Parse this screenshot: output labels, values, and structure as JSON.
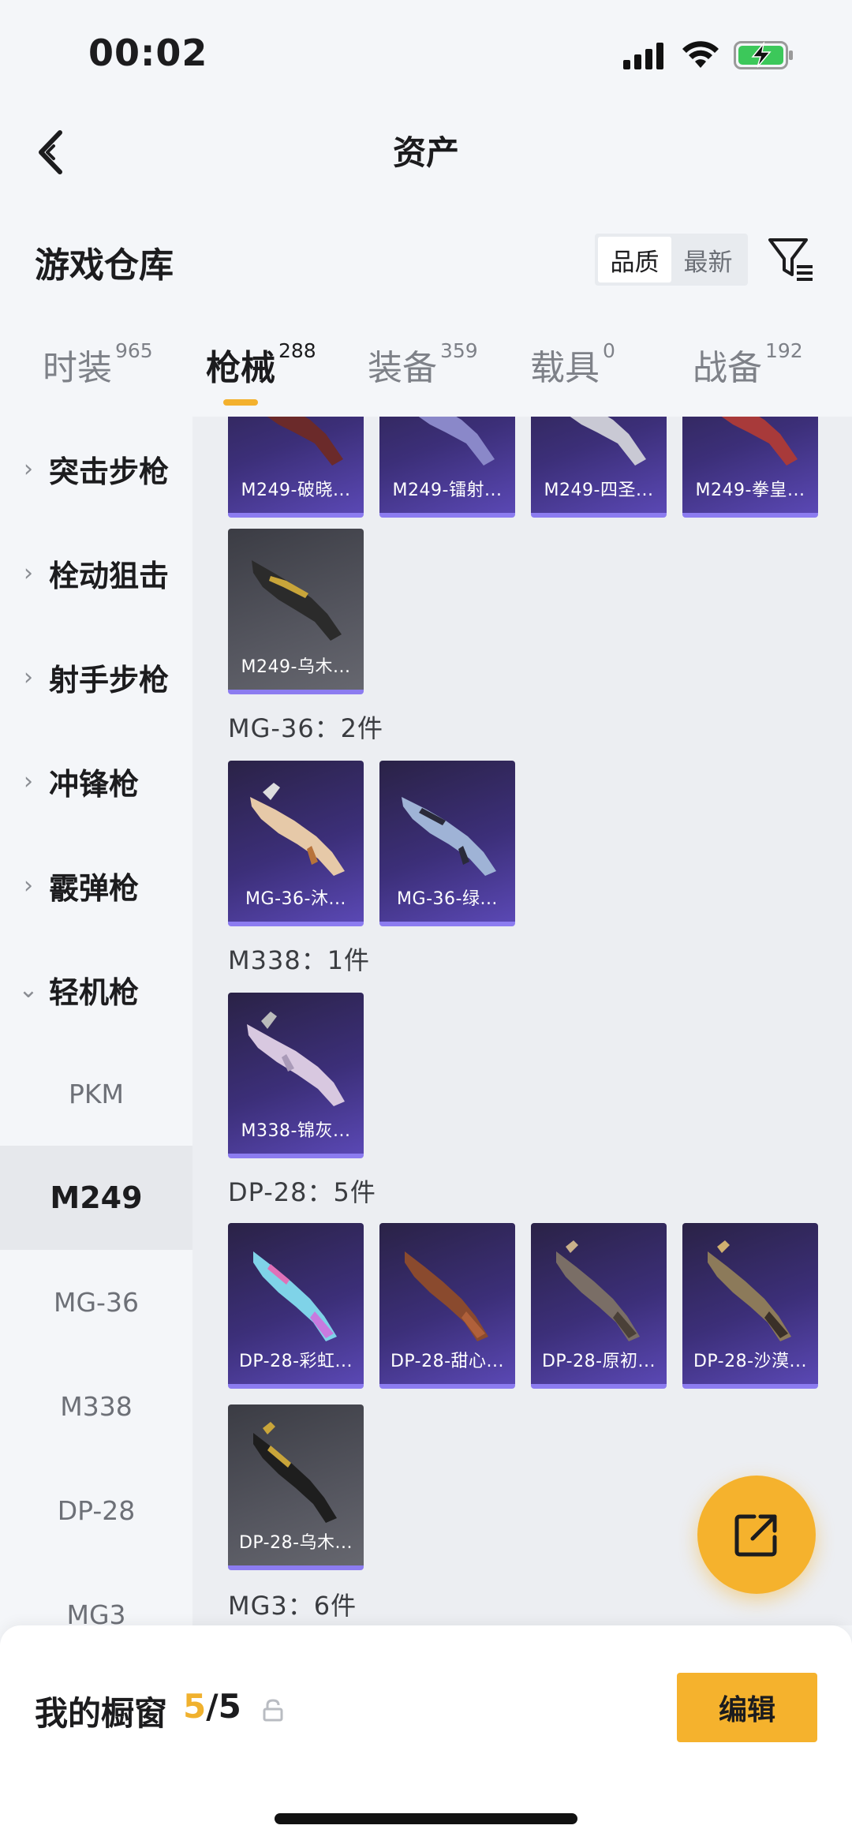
{
  "status_bar": {
    "time": "00:02"
  },
  "header": {
    "title": "资产"
  },
  "warehouse": {
    "title": "游戏仓库",
    "sort_options": [
      "品质",
      "最新"
    ],
    "sort_active": "品质"
  },
  "tabs": [
    {
      "label": "时装",
      "count": "965"
    },
    {
      "label": "枪械",
      "count": "288"
    },
    {
      "label": "装备",
      "count": "359"
    },
    {
      "label": "载具",
      "count": "0"
    },
    {
      "label": "战备",
      "count": "192"
    }
  ],
  "active_tab": "枪械",
  "sidebar": {
    "categories": [
      "突击步枪",
      "栓动狙击",
      "射手步枪",
      "冲锋枪",
      "霰弹枪",
      "轻机枪"
    ],
    "subitems": [
      "PKM",
      "M249",
      "MG-36",
      "M338",
      "DP-28",
      "MG3"
    ],
    "active_subitem": "M249"
  },
  "content": {
    "m249_row": [
      "M249-破晓...",
      "M249-镭射...",
      "M249-四圣...",
      "M249-拳皇..."
    ],
    "m249_extra": [
      "M249-乌木..."
    ],
    "groups": [
      {
        "label": "MG-36：2件",
        "items": [
          "MG-36-沐...",
          "MG-36-绿..."
        ]
      },
      {
        "label": "M338：1件",
        "items": [
          "M338-锦灰..."
        ]
      },
      {
        "label": "DP-28：5件",
        "items": [
          "DP-28-彩虹...",
          "DP-28-甜心...",
          "DP-28-原初...",
          "DP-28-沙漠...",
          "DP-28-乌木..."
        ]
      },
      {
        "label": "MG3：6件",
        "items": []
      }
    ]
  },
  "bottom_bar": {
    "showcase_title": "我的橱窗",
    "showcase_current": "5",
    "showcase_total": "/5",
    "edit_label": "编辑"
  },
  "colors": {
    "accent": "#f5b22d",
    "card_purple": "#3c2f79",
    "card_gray": "#55565f"
  },
  "icons": [
    "back-arrow-icon",
    "filter-icon",
    "share-icon",
    "lock-icon",
    "chevron-right-icon",
    "chevron-down-icon"
  ]
}
